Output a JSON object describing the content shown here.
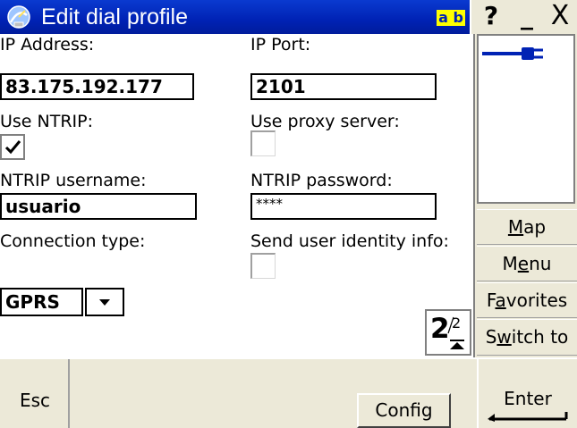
{
  "titlebar": {
    "title": "Edit dial profile",
    "input_mode": "a b",
    "help": "?",
    "minimize": "_",
    "close": "X",
    "colors": {
      "active": "#0022b4",
      "input_mode_bg": "#ffff00"
    }
  },
  "form": {
    "ip_address": {
      "label": "IP Address:",
      "value": "83.175.192.177"
    },
    "ip_port": {
      "label": "IP Port:",
      "value": "2101"
    },
    "use_ntrip": {
      "label": "Use NTRIP:",
      "checked": true
    },
    "use_proxy": {
      "label": "Use proxy server:",
      "checked": false
    },
    "ntrip_username": {
      "label": "NTRIP username:",
      "value": "usuario"
    },
    "ntrip_password": {
      "label": "NTRIP password:",
      "value": "****"
    },
    "connection_type": {
      "label": "Connection type:",
      "value": "GPRS"
    },
    "send_identity": {
      "label": "Send user identity info:",
      "checked": false
    }
  },
  "pager": {
    "current": "2",
    "total": "2"
  },
  "side": {
    "status_icon": "power-plug-icon",
    "map": {
      "pre": "",
      "u": "M",
      "post": "ap"
    },
    "menu": {
      "pre": "M",
      "u": "e",
      "post": "nu"
    },
    "favorites": {
      "pre": "F",
      "u": "a",
      "post": "vorites"
    },
    "switch_to": {
      "pre": "S",
      "u": "w",
      "post": "itch to"
    }
  },
  "bottom": {
    "esc": "Esc",
    "config": "Config",
    "enter": "Enter"
  }
}
